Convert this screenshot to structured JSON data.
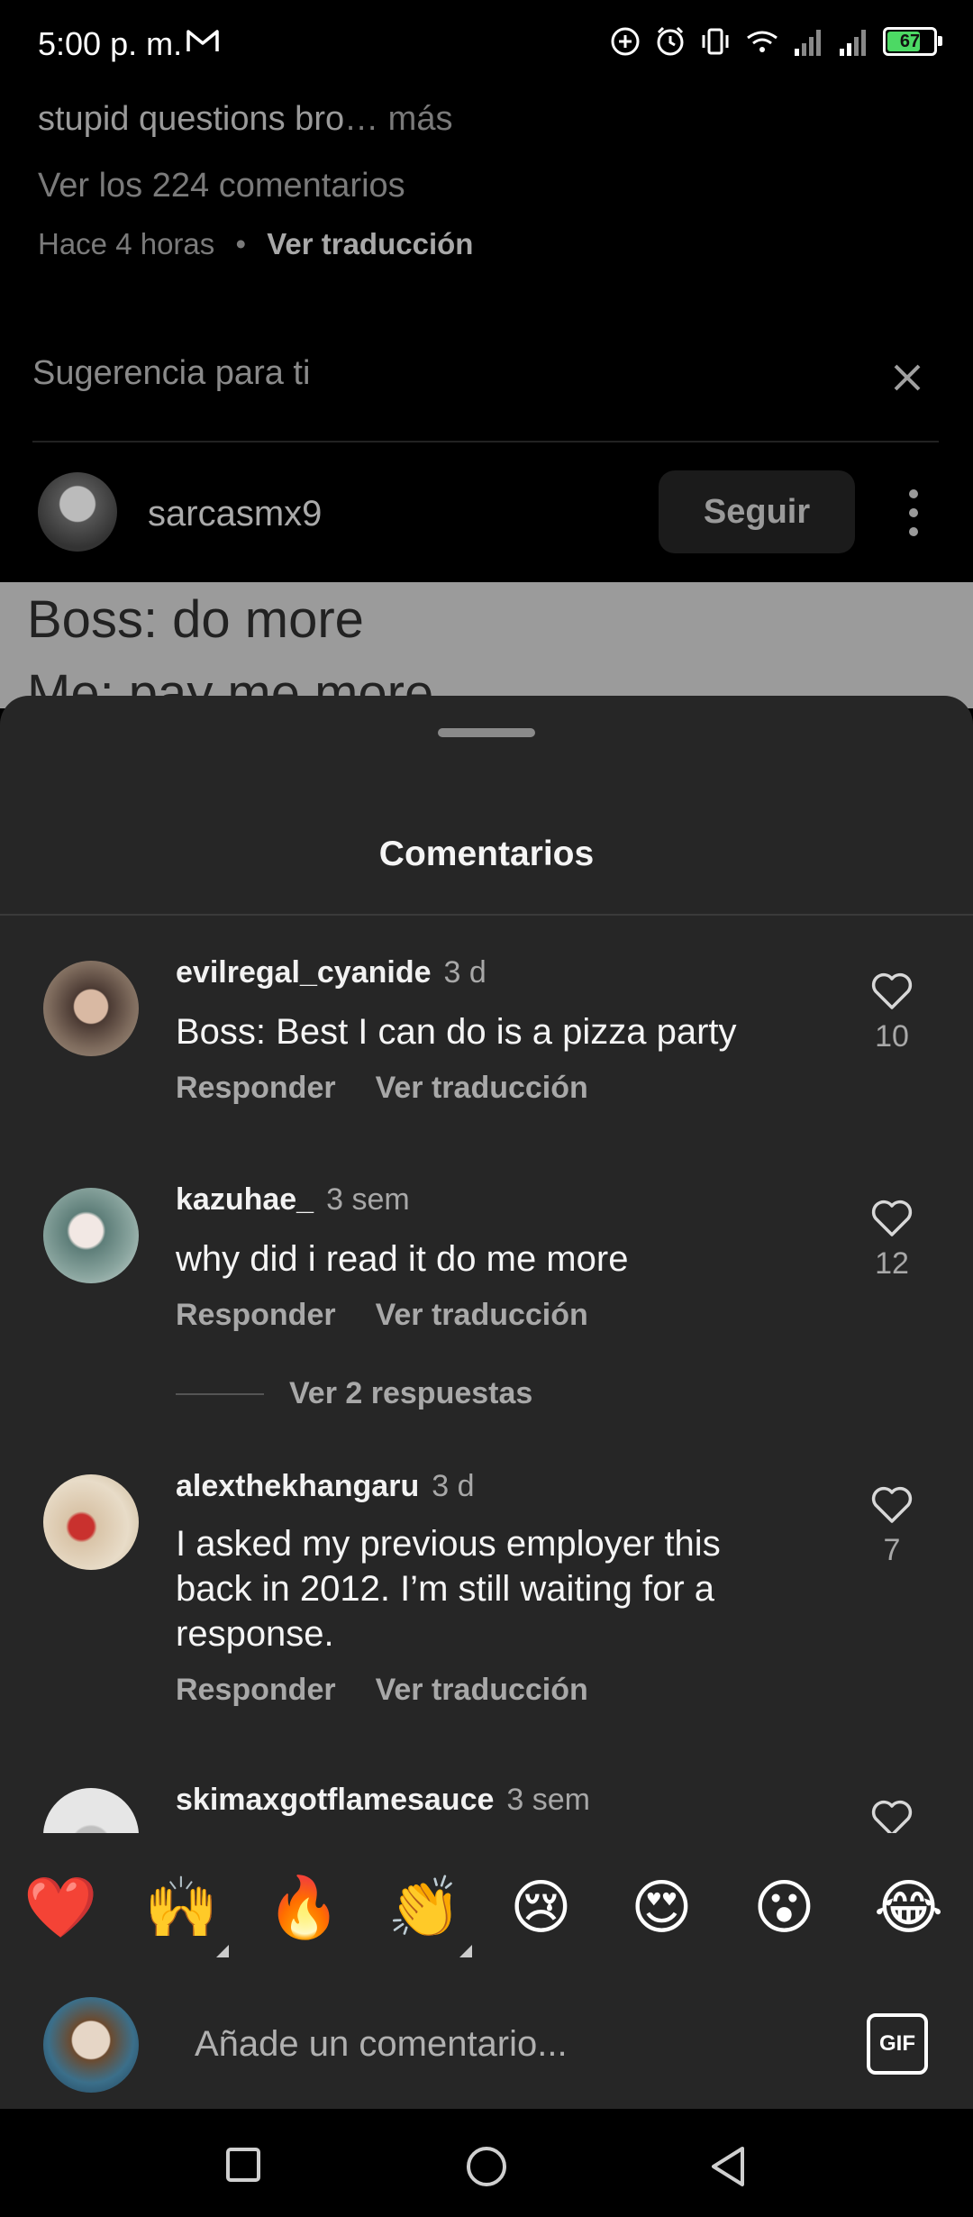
{
  "status_bar": {
    "time": "5:00 p. m.",
    "battery": "67"
  },
  "post": {
    "caption_tail": "stupid questions bro",
    "caption_more": "… más",
    "view_comments": "Ver los 224 comentarios",
    "time_ago": "Hace 4 horas",
    "separator": "•",
    "translate": "Ver traducción"
  },
  "suggestion": {
    "title": "Sugerencia para ti",
    "username": "sarcasmx9",
    "follow_label": "Seguir",
    "meme_line1": "Boss: do more",
    "meme_line2": "Me: pay me more"
  },
  "sheet": {
    "title": "Comentarios"
  },
  "comments": [
    {
      "user": "evilregal_cyanide",
      "time": "3 d",
      "text": "Boss: Best I can do is a pizza party",
      "reply": "Responder",
      "translate": "Ver traducción",
      "likes": "10"
    },
    {
      "user": "kazuhae_",
      "time": "3 sem",
      "text": "why did i read it do me more",
      "reply": "Responder",
      "translate": "Ver traducción",
      "likes": "12",
      "view_replies": "Ver 2 respuestas"
    },
    {
      "user": "alexthekhangaru",
      "time": "3 d",
      "text": "I asked my previous employer this back in 2012. I’m still waiting for a response.",
      "reply": "Responder",
      "translate": "Ver traducción",
      "likes": "7"
    },
    {
      "user": "skimaxgotflamesauce",
      "time": "3 sem"
    }
  ],
  "emoji_bar": [
    "❤️",
    "🙌",
    "🔥",
    "👏",
    "😢",
    "😍",
    "😮",
    "😂"
  ],
  "input": {
    "placeholder": "Añade un comentario...",
    "gif_label": "GIF"
  },
  "icons": {
    "heart": "heart-outline-icon",
    "close": "close-icon",
    "more": "more-vertical-icon",
    "nav": [
      "recents-square-icon",
      "home-circle-icon",
      "back-triangle-icon"
    ]
  },
  "colors": {
    "sheet_bg": "#262626",
    "page_bg": "#000000",
    "muted_text": "#a8a8a8",
    "battery_fill": "#4cd964"
  }
}
